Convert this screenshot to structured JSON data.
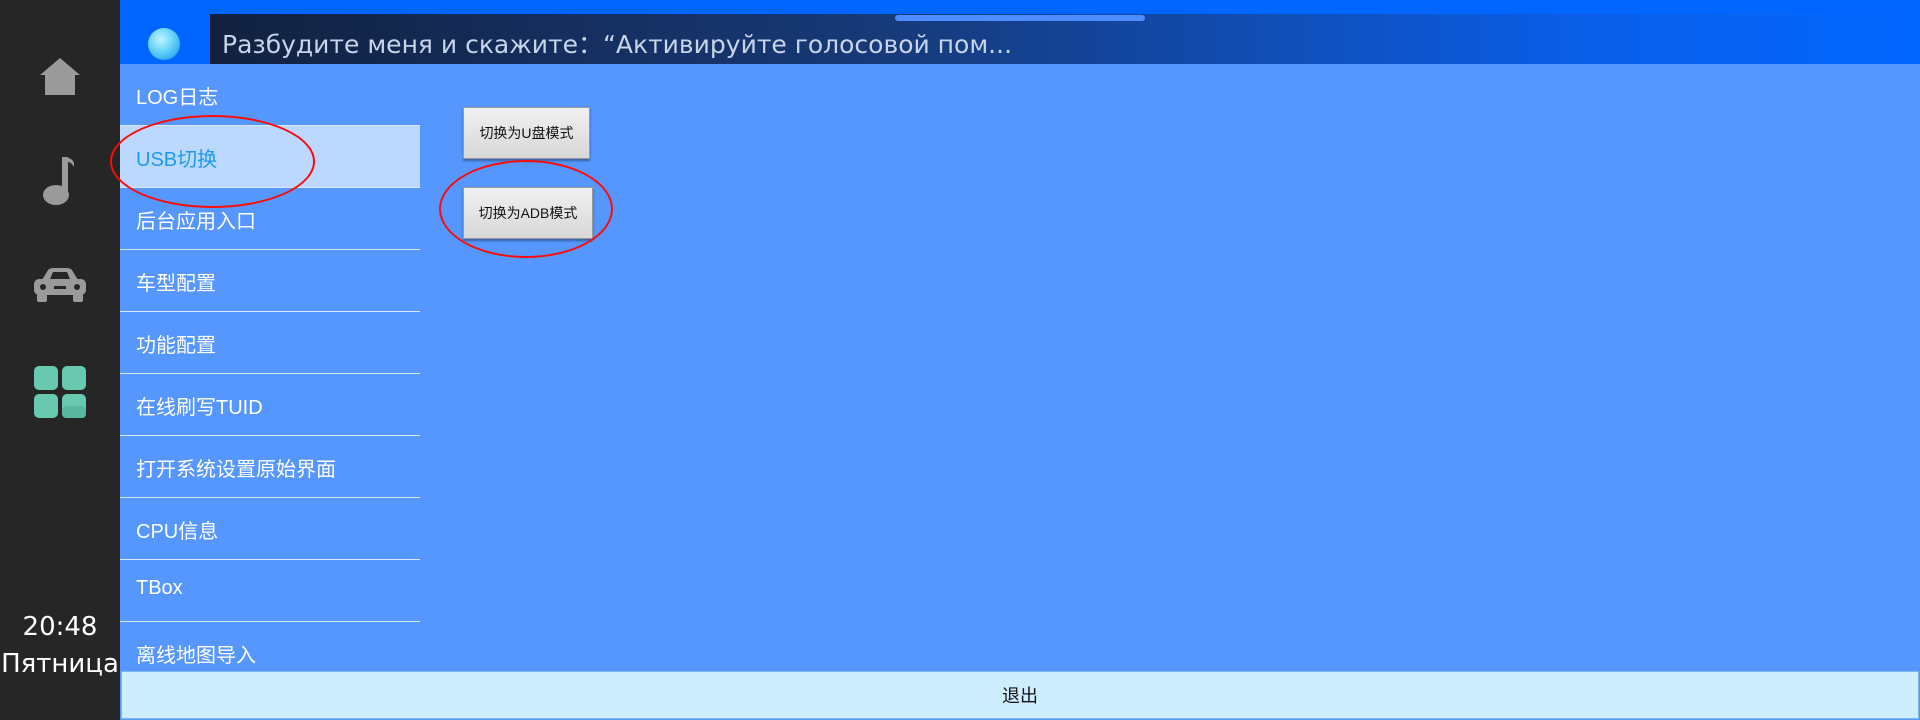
{
  "dock": {
    "items": [
      {
        "icon": "home-icon"
      },
      {
        "icon": "music-note-icon"
      },
      {
        "icon": "car-icon"
      },
      {
        "icon": "apps-grid-icon"
      }
    ],
    "time": "20:48",
    "day": "Пятница"
  },
  "voice": {
    "prompt": "Разбудите меня и скажите：“Активируйте голосовой пом..."
  },
  "menu": {
    "items": [
      {
        "label": "LOG日志"
      },
      {
        "label": "USB切换"
      },
      {
        "label": "后台应用入口"
      },
      {
        "label": "车型配置"
      },
      {
        "label": "功能配置"
      },
      {
        "label": "在线刷写TUID"
      },
      {
        "label": "打开系统设置原始界面"
      },
      {
        "label": "CPU信息"
      },
      {
        "label": "TBox"
      },
      {
        "label": "离线地图导入"
      }
    ],
    "selected_index": 1
  },
  "actions": {
    "udisk_mode_label": "切换为U盘模式",
    "adb_mode_label": "切换为ADB模式"
  },
  "exit_label": "退出",
  "colors": {
    "dock_bg": "#262626",
    "topbar_bg": "#0066ff",
    "content_bg": "#5597fe",
    "selected_item_bg": "#bcd8fe",
    "selected_item_text": "#1a9cee",
    "annotation": "#ff0a0a",
    "exit_bg": "#cdeeff"
  }
}
